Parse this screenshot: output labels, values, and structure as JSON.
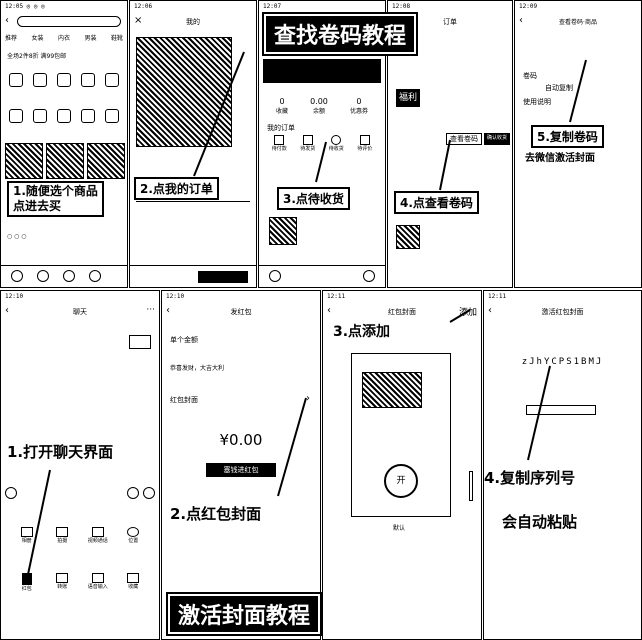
{
  "panels": {
    "p1": {
      "time": "12:05 ◎ ◎ ◎",
      "tabs": [
        "推荐",
        "女装",
        "内衣",
        "男装",
        "鞋靴"
      ],
      "promo": "全场2件8折 满99包邮",
      "caption": "1.随便选个商品\n点进去买"
    },
    "p2": {
      "time": "12:06",
      "title": "我的",
      "caption": "2.点我的订单"
    },
    "p3": {
      "time": "12:07",
      "stats": [
        {
          "value": "0",
          "label": "收藏"
        },
        {
          "value": "0.00",
          "label": "余额"
        },
        {
          "value": "0",
          "label": "优惠券"
        }
      ],
      "section": "我的订单",
      "order_icons": [
        "待付款",
        "待发货",
        "待收货",
        "待评价"
      ],
      "caption": "3.点待收货"
    },
    "p4": {
      "time": "12:08",
      "title": "订单",
      "stamp": "福利",
      "actions": [
        "查看卷码",
        "确认收货"
      ],
      "caption": "4.点查看卷码"
    },
    "p5": {
      "time": "12:09",
      "title": "查看卷码·商品",
      "lines": [
        "卷码",
        "自动复制",
        "使用说明"
      ],
      "caption": "5.复制卷码",
      "caption2": "去微信激活封面"
    }
  },
  "wechat": {
    "p6": {
      "time": "12:10",
      "title": "聊天",
      "tool_items": [
        "相册",
        "拍摄",
        "视频通话",
        "位置",
        "红包",
        "转账",
        "语音输入",
        "收藏"
      ],
      "caption": "1.打开聊天界面"
    },
    "p7": {
      "time": "12:10",
      "title": "发红包",
      "rows": [
        "单个金额",
        "恭喜发财，大吉大利",
        "红包封面"
      ],
      "amount": "¥0.00",
      "button": "塞钱进红包",
      "caption": "2.点红包封面"
    },
    "p8": {
      "time": "12:11",
      "title": "红包封面",
      "add": "添加",
      "open": "开",
      "footer": "默认",
      "caption": "3.点添加"
    },
    "p9": {
      "time": "12:11",
      "title": "激活红包封面",
      "serial": "zJhYCPS1BMJ",
      "caption": "4.复制序列号",
      "caption2": "会自动粘贴"
    }
  },
  "banners": {
    "top": "查找卷码教程",
    "bottom": "激活封面教程"
  },
  "colors": {
    "ink": "#000000",
    "paper": "#ffffff"
  }
}
